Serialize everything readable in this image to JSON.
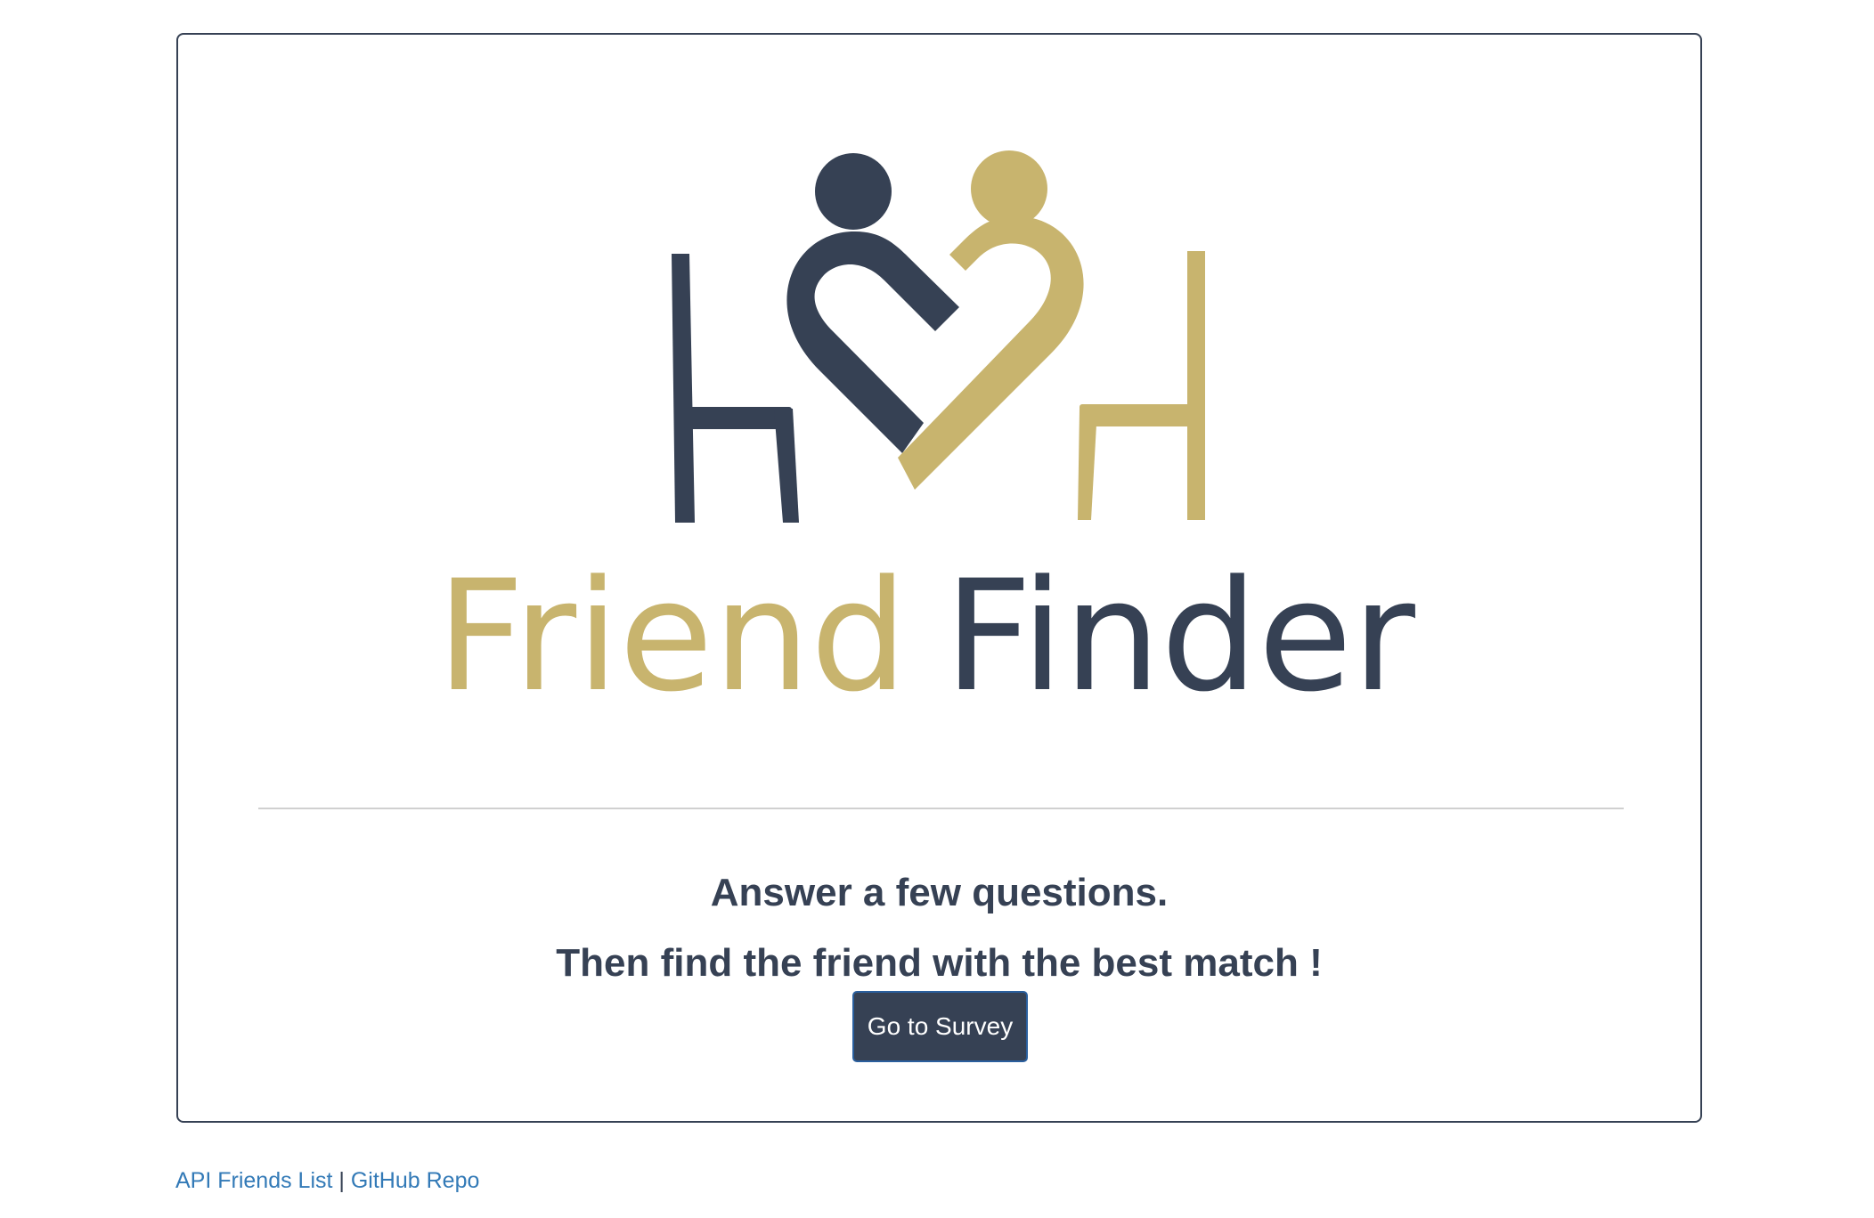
{
  "logo": {
    "word_friend": "Friend",
    "word_finder": "Finder",
    "colors": {
      "gold": "#c8b46e",
      "navy": "#364154"
    }
  },
  "main": {
    "tagline_line1": "Answer a few questions.",
    "tagline_line2": "Then find the friend with the best match !",
    "survey_button_label": "Go to Survey"
  },
  "footer": {
    "api_link_label": "API Friends List",
    "separator": "|",
    "github_link_label": "GitHub Repo"
  },
  "colors": {
    "card_border": "#364154",
    "button_bg": "#364154",
    "link": "#337ab7",
    "divider": "#d0d0d0"
  }
}
